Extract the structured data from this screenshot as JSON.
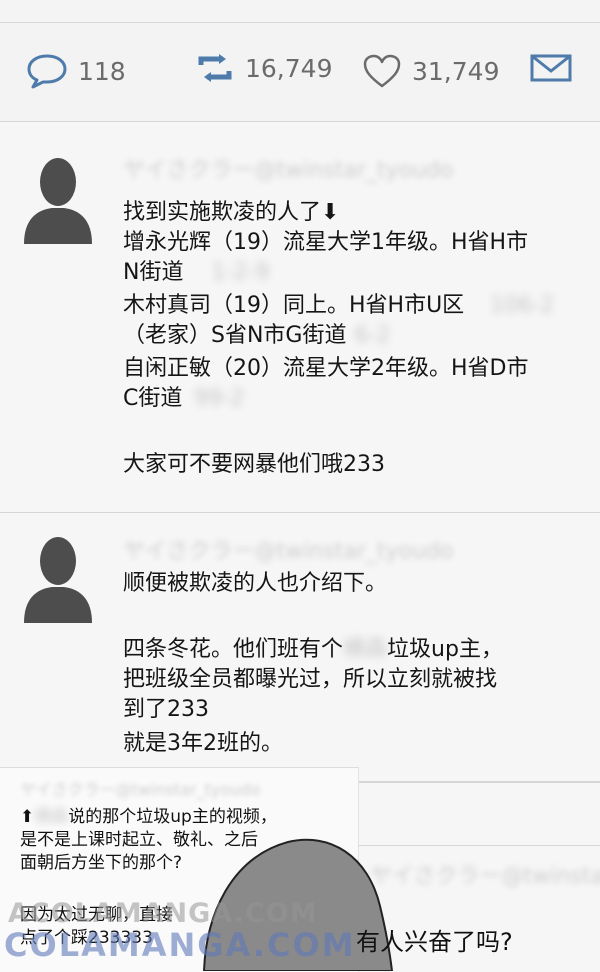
{
  "actions": {
    "reply_count": "118",
    "retweet_count": "16,749",
    "like_count": "31,749"
  },
  "tweet1": {
    "handle": "ヤイさクラー@twinstar_tyoudo",
    "lines": [
      "找到实施欺凌的人了⬇",
      "增永光辉（19）流星大学1年级。H省H市",
      "N街道",
      "1-2-9",
      "木村真司（19）同上。H省H市U区",
      "106-2",
      "（老家）S省N市G街道",
      "6-2",
      "自闲正敏（20）流星大学2年级。H省D市",
      "C街道",
      "99-2",
      "大家可不要网暴他们哦233"
    ]
  },
  "tweet2": {
    "handle": "ヤイさクラー@twinstar_tyoudo",
    "lines": [
      "顺便被欺凌的人也介绍下。",
      "四条冬花。他们班有个",
      "横森",
      "垃圾up主，",
      "把班级全员都曝光过，所以立刻就被找",
      "到了233",
      "就是3年2班的。"
    ]
  },
  "bubble": {
    "handle": "ヤイさクラー@twinstar_tyoudo",
    "lines": [
      "⬆",
      "横森",
      "说的那个垃圾up主的视频，",
      "是不是上课时起立、敬礼、之后",
      "面朝后方坐下的那个?",
      "因为太过无聊，直接",
      "点了个踩233333"
    ]
  },
  "tweet3": {
    "handle": "ヤイさクラー@twinstar"
  },
  "caption": "有人兴奋了吗?",
  "watermark": {
    "line1": "ACOLAMANGA.COM",
    "line2": "COLAMANGA.COM"
  }
}
